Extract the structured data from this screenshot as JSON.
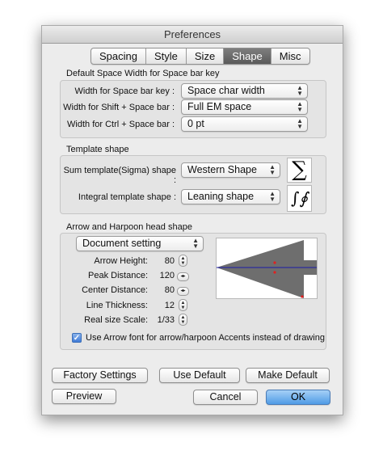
{
  "window": {
    "title": "Preferences"
  },
  "tabs": [
    {
      "label": "Spacing",
      "active": false
    },
    {
      "label": "Style",
      "active": false
    },
    {
      "label": "Size",
      "active": false
    },
    {
      "label": "Shape",
      "active": true
    },
    {
      "label": "Misc",
      "active": false
    }
  ],
  "space_width": {
    "title": "Default Space Width for Space bar key",
    "rows": [
      {
        "label": "Width for Space bar key :",
        "value": "Space char width"
      },
      {
        "label": "Width for Shift + Space bar :",
        "value": "Full EM space"
      },
      {
        "label": "Width for Ctrl + Space bar :",
        "value": "0 pt"
      }
    ]
  },
  "template_shape": {
    "title": "Template shape",
    "rows": [
      {
        "label": "Sum template(Sigma) shape :",
        "value": "Western Shape",
        "preview": "∑"
      },
      {
        "label": "Integral template shape :",
        "value": "Leaning shape",
        "preview": "∫∮"
      }
    ]
  },
  "arrow": {
    "title": "Arrow and Harpoon head shape",
    "setting": "Document setting",
    "fields": [
      {
        "label": "Arrow Height:",
        "value": "80"
      },
      {
        "label": "Peak Distance:",
        "value": "120"
      },
      {
        "label": "Center Distance:",
        "value": "80"
      },
      {
        "label": "Line Thickness:",
        "value": "12"
      },
      {
        "label": "Real size Scale:",
        "value": "1/33"
      }
    ],
    "checkbox": {
      "label": "Use Arrow font for arrow/harpoon Accents instead of drawing",
      "checked": true
    }
  },
  "buttons": {
    "factory": "Factory Settings",
    "use_default": "Use Default",
    "make_default": "Make Default",
    "preview": "Preview",
    "cancel": "Cancel",
    "ok": "OK"
  },
  "colors": {
    "accent": "#4f9be6",
    "arrow_fill": "#6e6e6e",
    "guide_line": "#1a1aa8",
    "point": "#e02020"
  }
}
